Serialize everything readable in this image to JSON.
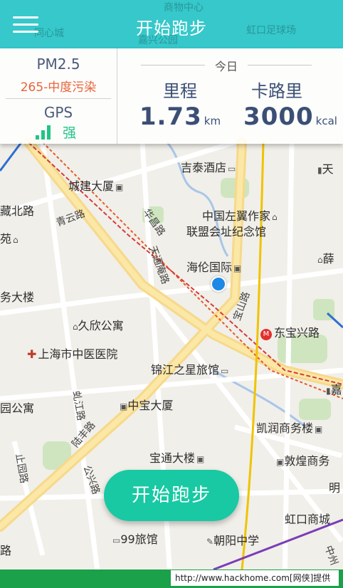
{
  "header": {
    "title": "开始跑步"
  },
  "stats": {
    "pm_label": "PM2.5",
    "pm_value": "265-中度污染",
    "gps_label": "GPS",
    "gps_strength": "强",
    "today_label": "今日",
    "distance_title": "里程",
    "distance_value": "1.73",
    "distance_unit": "km",
    "calorie_title": "卡路里",
    "calorie_value": "3000",
    "calorie_unit": "kcal"
  },
  "map_header_labels": [
    "商物中心",
    "同心城",
    "嘉兴公园",
    "虹口足球场"
  ],
  "map_labels": {
    "jitai_hotel": "吉泰酒店",
    "tian": "天",
    "chengjian_tower": "城建大厦",
    "zuolian": "中国左翼作家",
    "zuolian2": "联盟会址纪念馆",
    "xue": "薛",
    "hailun": "海伦国际",
    "dongbaoxing": "东宝兴路",
    "jiuxin": "久欣公寓",
    "tcm_hospital": "上海市中医医院",
    "jinjiang": "锦江之星旅馆",
    "zhongbao": "中宝大厦",
    "yuan_gongyu": "园公寓",
    "kairun": "凯润商务楼",
    "baotong": "宝通大楼",
    "dunhuang": "敦煌商务",
    "ming": "明",
    "hongkou_mall": "虹口商城",
    "hotel99": "99旅馆",
    "chaoyang": "朝阳中学",
    "cangbei": "藏北路",
    "yuan": "苑",
    "wuda": "务大楼",
    "jia": "嘉",
    "lu": "路"
  },
  "road_labels": {
    "qingyun": "青云路",
    "huachang": "华昌路",
    "tianshou": "天通庵路",
    "baoshan": "宝山路",
    "lufeng": "陆丰路",
    "gonglu": "公兴路",
    "zhiyuan": "止园路",
    "xiangshan": "虬江路",
    "zhongzhou": "中州"
  },
  "action": {
    "start_label": "开始跑步"
  },
  "footer": {
    "text": "http://www.hackhome.com[网侠]提供"
  },
  "colors": {
    "header": "#26c4c8",
    "start_button": "#18c9a3",
    "pm_value": "#e8633a",
    "gps_strength": "#23c486",
    "stat_text": "#3b4f75",
    "location_dot": "#1e88e5",
    "footer": "#1aa14a"
  }
}
